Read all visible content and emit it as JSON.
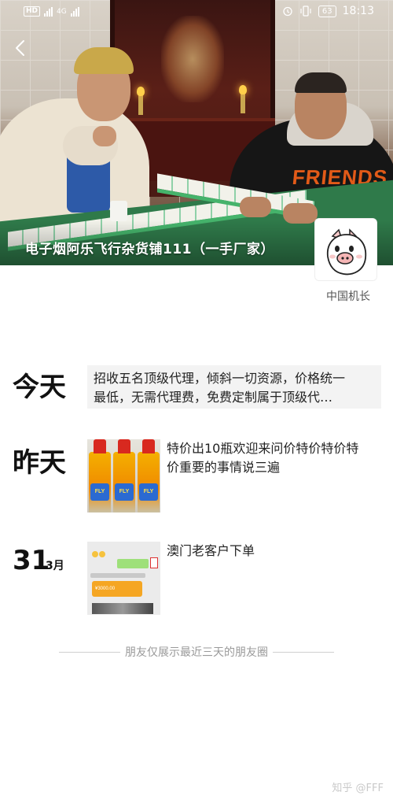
{
  "status_bar": {
    "hd": "HD",
    "network": "4G",
    "battery": "63",
    "time": "18:13"
  },
  "cover": {
    "title": "电子烟阿乐飞行杂货铺111（一手厂家）",
    "owner_name": "中国机长",
    "shirt_print": "FRIENDS"
  },
  "posts": [
    {
      "day": "今天",
      "lines": [
        "招收五名顶级代理，倾斜一切资源，价格统一",
        "最低，无需代理费，免费定制属于顶级代…"
      ]
    },
    {
      "day": "昨天",
      "lines": [
        "特价出10瓶欢迎来问价特价特价特",
        "价重要的事情说三遍"
      ],
      "bottle_label": "FLY"
    },
    {
      "day_number": "31",
      "month": "3月",
      "lines": [
        "澳门老客户下单"
      ],
      "chat_amount": "¥3000.00"
    }
  ],
  "footer": {
    "limit_note": "朋友仅展示最近三天的朋友圈",
    "watermark": "知乎 @FFF"
  },
  "colors": {
    "background": "#ffffff",
    "text_box_bg": "#f3f3f3",
    "muted_text": "#9a9a9a"
  },
  "icons": [
    "back-arrow-icon",
    "pig-avatar-icon",
    "signal-icon",
    "vibrate-icon",
    "alarm-icon"
  ]
}
